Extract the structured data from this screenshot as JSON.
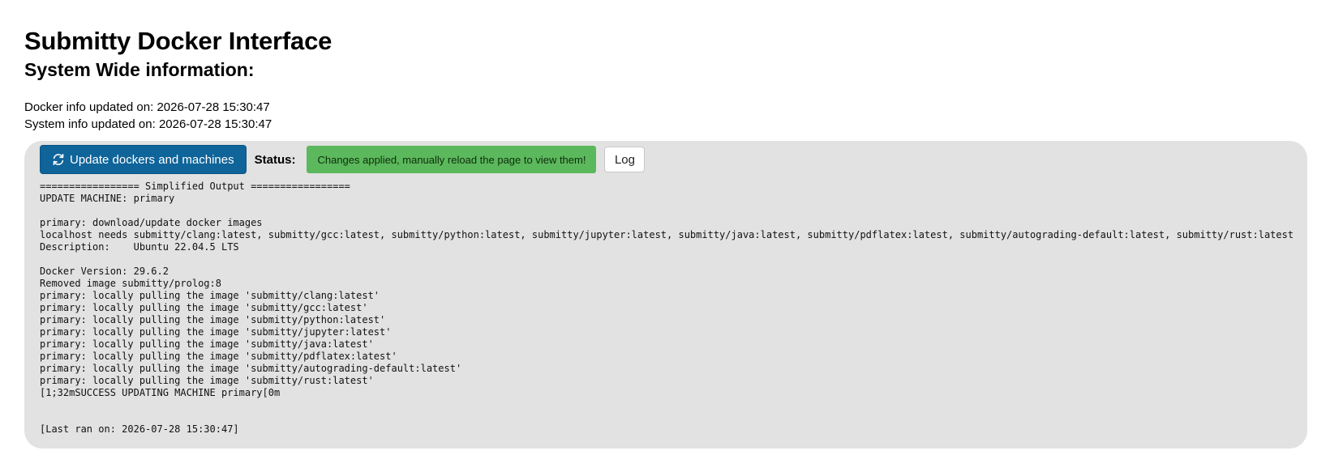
{
  "header": {
    "title": "Submitty Docker Interface",
    "subtitle": "System Wide information:"
  },
  "info": {
    "docker_updated": "Docker info updated on: 2026-07-28 15:30:47",
    "system_updated": "System info updated on: 2026-07-28 15:30:47"
  },
  "toolbar": {
    "update_label": "Update dockers and machines",
    "update_icon": "refresh-icon",
    "status_label": "Status:",
    "status_message": "Changes applied, manually reload the page to view them!",
    "log_label": "Log"
  },
  "colors": {
    "update_button": "#0f6499",
    "status_badge": "#5cb85c",
    "panel_background": "#e2e2e2"
  },
  "output": {
    "text": "================= Simplified Output =================\nUPDATE MACHINE: primary\n\nprimary: download/update docker images\nlocalhost needs submitty/clang:latest, submitty/gcc:latest, submitty/python:latest, submitty/jupyter:latest, submitty/java:latest, submitty/pdflatex:latest, submitty/autograding-default:latest, submitty/rust:latest\nDescription:    Ubuntu 22.04.5 LTS\n\nDocker Version: 29.6.2\nRemoved image submitty/prolog:8\nprimary: locally pulling the image 'submitty/clang:latest'\nprimary: locally pulling the image 'submitty/gcc:latest'\nprimary: locally pulling the image 'submitty/python:latest'\nprimary: locally pulling the image 'submitty/jupyter:latest'\nprimary: locally pulling the image 'submitty/java:latest'\nprimary: locally pulling the image 'submitty/pdflatex:latest'\nprimary: locally pulling the image 'submitty/autograding-default:latest'\nprimary: locally pulling the image 'submitty/rust:latest'\n[1;32mSUCCESS UPDATING MACHINE primary[0m\n\n\n[Last ran on: 2026-07-28 15:30:47]"
  }
}
